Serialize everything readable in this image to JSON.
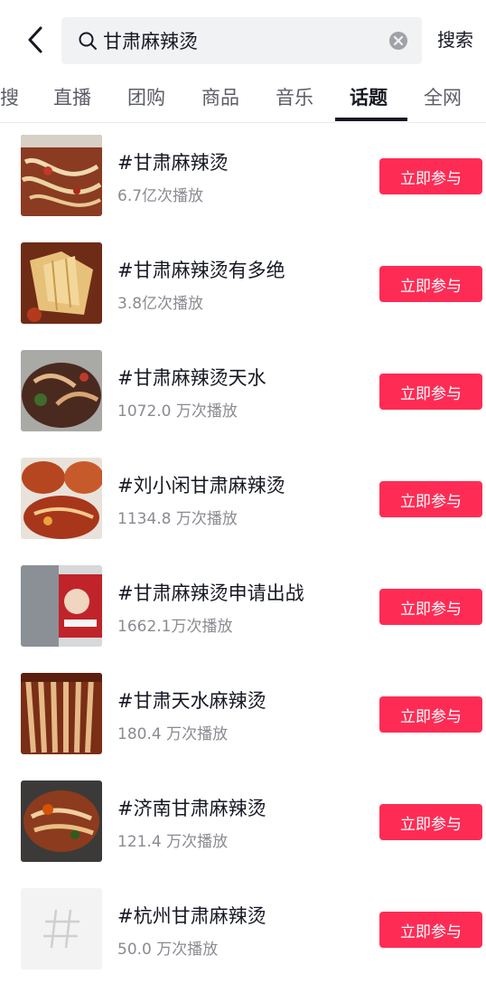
{
  "search": {
    "query": "甘肃麻辣烫",
    "button_label": "搜索"
  },
  "tabs": [
    {
      "label": "搜",
      "active": false
    },
    {
      "label": "直播",
      "active": false
    },
    {
      "label": "团购",
      "active": false
    },
    {
      "label": "商品",
      "active": false
    },
    {
      "label": "音乐",
      "active": false
    },
    {
      "label": "话题",
      "active": true
    },
    {
      "label": "全网",
      "active": false
    }
  ],
  "colors": {
    "accent": "#fe2c55",
    "text_primary": "#161823",
    "text_secondary": "#8a8b91"
  },
  "topics": [
    {
      "title": "#甘肃麻辣烫",
      "views": "6.7亿次播放",
      "button": "立即参与",
      "thumb": "food-photo"
    },
    {
      "title": "#甘肃麻辣烫有多绝",
      "views": "3.8亿次播放",
      "button": "立即参与",
      "thumb": "food-photo"
    },
    {
      "title": "#甘肃麻辣烫天水",
      "views": "1072.0 万次播放",
      "button": "立即参与",
      "thumb": "food-photo"
    },
    {
      "title": "#刘小闲甘肃麻辣烫",
      "views": "1134.8 万次播放",
      "button": "立即参与",
      "thumb": "food-photo"
    },
    {
      "title": "#甘肃麻辣烫申请出战",
      "views": "1662.1万次播放",
      "button": "立即参与",
      "thumb": "shop-photo"
    },
    {
      "title": "#甘肃天水麻辣烫",
      "views": "180.4 万次播放",
      "button": "立即参与",
      "thumb": "food-photo"
    },
    {
      "title": "#济南甘肃麻辣烫",
      "views": "121.4 万次播放",
      "button": "立即参与",
      "thumb": "food-photo"
    },
    {
      "title": "#杭州甘肃麻辣烫",
      "views": "50.0 万次播放",
      "button": "立即参与",
      "thumb": "hashtag-icon"
    }
  ]
}
